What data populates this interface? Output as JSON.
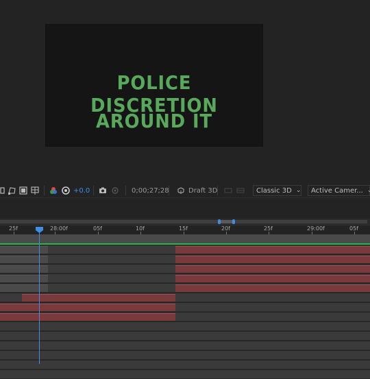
{
  "composition": {
    "line1": "POLICE DISCRETION",
    "line2": "AROUND IT"
  },
  "viewer_toolbar": {
    "exposure_value": "+0.0",
    "timecode": "0;00;27;28",
    "draft_3d_label": "Draft 3D",
    "renderer": "Classic 3D",
    "camera": "Active Camer..."
  },
  "timeline": {
    "ruler_ticks": [
      "25f",
      "28:00f",
      "05f",
      "10f",
      "15f",
      "20f",
      "25f",
      "29:00f",
      "05f"
    ],
    "colors": {
      "playhead": "#3d8ee6",
      "work_area_line": "#29b84a",
      "layer_bar": "#7a3a3c"
    }
  }
}
